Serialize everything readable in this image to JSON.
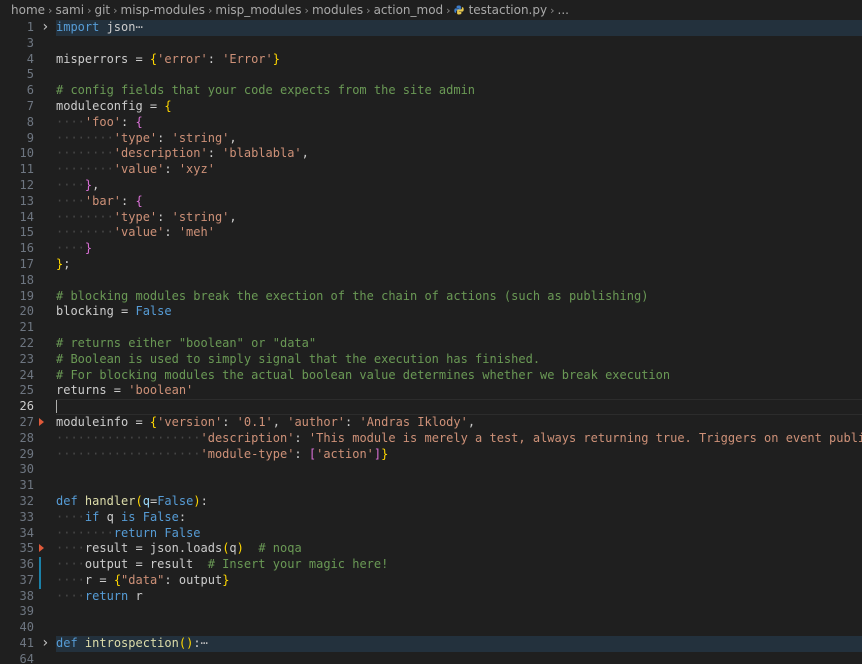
{
  "breadcrumb": {
    "items": [
      "home",
      "sami",
      "git",
      "misp-modules",
      "misp_modules",
      "modules",
      "action_mod"
    ],
    "file": "testaction.py",
    "more": "..."
  },
  "colors": {
    "keyword": "#569cd6",
    "string": "#ce9178",
    "comment": "#6a9955",
    "bracket_gold": "#ffd700",
    "bracket_purple": "#da70d6",
    "function": "#dcdcaa"
  },
  "editor": {
    "current_line": 26,
    "lines": [
      {
        "n": 1,
        "fold": true,
        "folded": true,
        "parts": [
          {
            "t": "import",
            "c": "kw"
          },
          {
            "t": " json",
            "c": ""
          },
          {
            "t": "⋯",
            "c": "ell"
          }
        ]
      },
      {
        "n": 3,
        "parts": []
      },
      {
        "n": 4,
        "parts": [
          {
            "t": "misperrors = ",
            "c": ""
          },
          {
            "t": "{",
            "c": "br1"
          },
          {
            "t": "'error'",
            "c": "str"
          },
          {
            "t": ": ",
            "c": ""
          },
          {
            "t": "'Error'",
            "c": "str"
          },
          {
            "t": "}",
            "c": "br1"
          }
        ]
      },
      {
        "n": 5,
        "parts": []
      },
      {
        "n": 6,
        "parts": [
          {
            "t": "# config fields that your code expects from the site admin",
            "c": "cmt"
          }
        ]
      },
      {
        "n": 7,
        "parts": [
          {
            "t": "moduleconfig = ",
            "c": ""
          },
          {
            "t": "{",
            "c": "br1"
          }
        ]
      },
      {
        "n": 8,
        "indent": 1,
        "parts": [
          {
            "t": "'foo'",
            "c": "str"
          },
          {
            "t": ": ",
            "c": ""
          },
          {
            "t": "{",
            "c": "br2"
          }
        ]
      },
      {
        "n": 9,
        "indent": 2,
        "parts": [
          {
            "t": "'type'",
            "c": "str"
          },
          {
            "t": ": ",
            "c": ""
          },
          {
            "t": "'string'",
            "c": "str"
          },
          {
            "t": ",",
            "c": ""
          }
        ]
      },
      {
        "n": 10,
        "indent": 2,
        "parts": [
          {
            "t": "'description'",
            "c": "str"
          },
          {
            "t": ": ",
            "c": ""
          },
          {
            "t": "'blablabla'",
            "c": "str"
          },
          {
            "t": ",",
            "c": ""
          }
        ]
      },
      {
        "n": 11,
        "indent": 2,
        "parts": [
          {
            "t": "'value'",
            "c": "str"
          },
          {
            "t": ": ",
            "c": ""
          },
          {
            "t": "'xyz'",
            "c": "str"
          }
        ]
      },
      {
        "n": 12,
        "indent": 1,
        "parts": [
          {
            "t": "}",
            "c": "br2"
          },
          {
            "t": ",",
            "c": ""
          }
        ]
      },
      {
        "n": 13,
        "indent": 1,
        "parts": [
          {
            "t": "'bar'",
            "c": "str"
          },
          {
            "t": ": ",
            "c": ""
          },
          {
            "t": "{",
            "c": "br2"
          }
        ]
      },
      {
        "n": 14,
        "indent": 2,
        "parts": [
          {
            "t": "'type'",
            "c": "str"
          },
          {
            "t": ": ",
            "c": ""
          },
          {
            "t": "'string'",
            "c": "str"
          },
          {
            "t": ",",
            "c": ""
          }
        ]
      },
      {
        "n": 15,
        "indent": 2,
        "parts": [
          {
            "t": "'value'",
            "c": "str"
          },
          {
            "t": ": ",
            "c": ""
          },
          {
            "t": "'meh'",
            "c": "str"
          }
        ]
      },
      {
        "n": 16,
        "indent": 1,
        "parts": [
          {
            "t": "}",
            "c": "br2"
          }
        ]
      },
      {
        "n": 17,
        "parts": [
          {
            "t": "}",
            "c": "br1"
          },
          {
            "t": ";",
            "c": ""
          }
        ]
      },
      {
        "n": 18,
        "parts": []
      },
      {
        "n": 19,
        "parts": [
          {
            "t": "# blocking modules break the exection of the chain of actions (such as publishing)",
            "c": "cmt"
          }
        ]
      },
      {
        "n": 20,
        "parts": [
          {
            "t": "blocking = ",
            "c": ""
          },
          {
            "t": "False",
            "c": "kw"
          }
        ]
      },
      {
        "n": 21,
        "parts": []
      },
      {
        "n": 22,
        "parts": [
          {
            "t": "# returns either \"boolean\" or \"data\"",
            "c": "cmt"
          }
        ]
      },
      {
        "n": 23,
        "parts": [
          {
            "t": "# Boolean is used to simply signal that the execution has finished.",
            "c": "cmt"
          }
        ]
      },
      {
        "n": 24,
        "parts": [
          {
            "t": "# For blocking modules the actual boolean value determines whether we break execution",
            "c": "cmt"
          }
        ]
      },
      {
        "n": 25,
        "parts": [
          {
            "t": "returns = ",
            "c": ""
          },
          {
            "t": "'boolean'",
            "c": "str"
          }
        ]
      },
      {
        "n": 26,
        "cursor": true,
        "parts": []
      },
      {
        "n": 27,
        "marker": true,
        "parts": [
          {
            "t": "moduleinfo = ",
            "c": ""
          },
          {
            "t": "{",
            "c": "br1"
          },
          {
            "t": "'version'",
            "c": "str"
          },
          {
            "t": ": ",
            "c": ""
          },
          {
            "t": "'0.1'",
            "c": "str"
          },
          {
            "t": ", ",
            "c": ""
          },
          {
            "t": "'author'",
            "c": "str"
          },
          {
            "t": ": ",
            "c": ""
          },
          {
            "t": "'Andras Iklody'",
            "c": "str"
          },
          {
            "t": ",",
            "c": ""
          }
        ]
      },
      {
        "n": 28,
        "indent": 5,
        "parts": [
          {
            "t": "'description'",
            "c": "str"
          },
          {
            "t": ": ",
            "c": ""
          },
          {
            "t": "'This module is merely a test, always returning true. Triggers on event publishing.'",
            "c": "str"
          },
          {
            "t": ",",
            "c": ""
          }
        ]
      },
      {
        "n": 29,
        "indent": 5,
        "parts": [
          {
            "t": "'module-type'",
            "c": "str"
          },
          {
            "t": ": ",
            "c": ""
          },
          {
            "t": "[",
            "c": "br2"
          },
          {
            "t": "'action'",
            "c": "str"
          },
          {
            "t": "]",
            "c": "br2"
          },
          {
            "t": "}",
            "c": "br1"
          }
        ]
      },
      {
        "n": 30,
        "parts": []
      },
      {
        "n": 31,
        "parts": []
      },
      {
        "n": 32,
        "parts": [
          {
            "t": "def",
            "c": "kw"
          },
          {
            "t": " ",
            "c": ""
          },
          {
            "t": "handler",
            "c": "fn"
          },
          {
            "t": "(",
            "c": "br1"
          },
          {
            "t": "q",
            "c": "var"
          },
          {
            "t": "=",
            "c": ""
          },
          {
            "t": "False",
            "c": "kw"
          },
          {
            "t": ")",
            "c": "br1"
          },
          {
            "t": ":",
            "c": ""
          }
        ]
      },
      {
        "n": 33,
        "indent": 1,
        "parts": [
          {
            "t": "if",
            "c": "kw"
          },
          {
            "t": " q ",
            "c": ""
          },
          {
            "t": "is",
            "c": "kw"
          },
          {
            "t": " ",
            "c": ""
          },
          {
            "t": "False",
            "c": "kw"
          },
          {
            "t": ":",
            "c": ""
          }
        ]
      },
      {
        "n": 34,
        "indent": 2,
        "parts": [
          {
            "t": "return",
            "c": "kw"
          },
          {
            "t": " ",
            "c": ""
          },
          {
            "t": "False",
            "c": "kw"
          }
        ]
      },
      {
        "n": 35,
        "indent": 1,
        "marker": true,
        "parts": [
          {
            "t": "result = json.loads",
            "c": ""
          },
          {
            "t": "(",
            "c": "br1"
          },
          {
            "t": "q",
            "c": ""
          },
          {
            "t": ")",
            "c": "br1"
          },
          {
            "t": "  ",
            "c": ""
          },
          {
            "t": "# noqa",
            "c": "cmt"
          }
        ]
      },
      {
        "n": 36,
        "indent": 1,
        "mod": true,
        "parts": [
          {
            "t": "output = result  ",
            "c": ""
          },
          {
            "t": "# Insert your magic here!",
            "c": "cmt"
          }
        ]
      },
      {
        "n": 37,
        "indent": 1,
        "mod": true,
        "parts": [
          {
            "t": "r = ",
            "c": ""
          },
          {
            "t": "{",
            "c": "br1"
          },
          {
            "t": "\"data\"",
            "c": "str"
          },
          {
            "t": ": output",
            "c": ""
          },
          {
            "t": "}",
            "c": "br1"
          }
        ]
      },
      {
        "n": 38,
        "indent": 1,
        "parts": [
          {
            "t": "return",
            "c": "kw"
          },
          {
            "t": " r",
            "c": ""
          }
        ]
      },
      {
        "n": 39,
        "parts": []
      },
      {
        "n": 40,
        "parts": []
      },
      {
        "n": 41,
        "fold": true,
        "folded": true,
        "parts": [
          {
            "t": "def",
            "c": "kw"
          },
          {
            "t": " ",
            "c": ""
          },
          {
            "t": "introspection",
            "c": "fn"
          },
          {
            "t": "(",
            "c": "br1"
          },
          {
            "t": ")",
            "c": "br1"
          },
          {
            "t": ":",
            "c": ""
          },
          {
            "t": "⋯",
            "c": "ell"
          }
        ]
      },
      {
        "n": 64,
        "parts": []
      }
    ]
  }
}
